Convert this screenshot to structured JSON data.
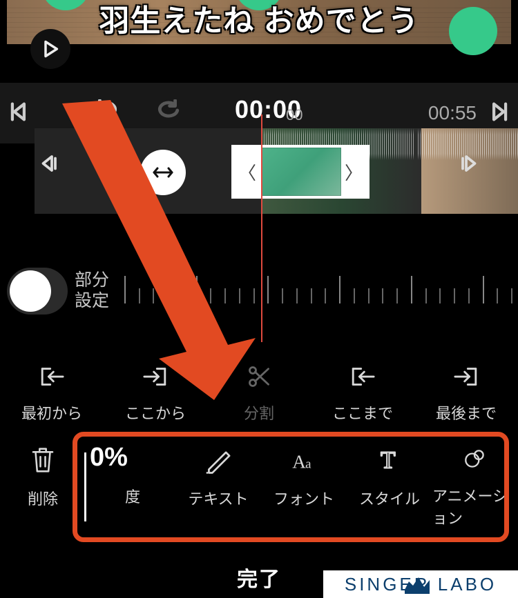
{
  "preview": {
    "caption": "羽生えたね おめでとう"
  },
  "transport": {
    "current_time": "00:00",
    "current_ms": "00",
    "duration": "00:55"
  },
  "partial_toggle": {
    "label_line1": "部分",
    "label_line2": "設定",
    "enabled": false
  },
  "trim": {
    "from_start": "最初から",
    "from_here": "ここから",
    "split": "分割",
    "to_here": "ここまで",
    "to_end": "最後まで"
  },
  "tools": {
    "delete": "削除",
    "opacity_value": "0%",
    "opacity_label": "度",
    "text": "テキスト",
    "font": "フォント",
    "style": "スタイル",
    "animation": "アニメーション"
  },
  "done": "完了",
  "watermark": "SINGER LABO"
}
